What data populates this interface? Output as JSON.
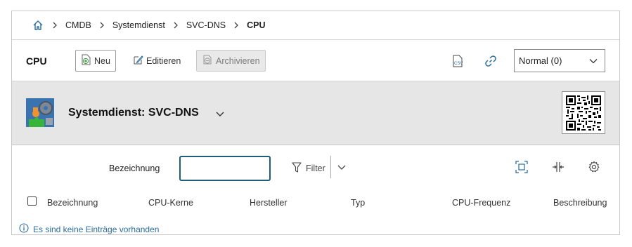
{
  "breadcrumb": {
    "items": [
      "CMDB",
      "Systemdienst",
      "SVC-DNS",
      "CPU"
    ]
  },
  "toolbar": {
    "title": "CPU",
    "new_label": "Neu",
    "edit_label": "Editieren",
    "archive_label": "Archivieren",
    "view_select": "Normal (0)"
  },
  "object": {
    "title": "Systemdienst: SVC-DNS"
  },
  "filter": {
    "label": "Bezeichnung",
    "value": "",
    "button_label": "Filter"
  },
  "table": {
    "columns": [
      "Bezeichnung",
      "CPU-Kerne",
      "Hersteller",
      "Typ",
      "CPU-Frequenz",
      "Beschreibung"
    ],
    "rows": []
  },
  "empty_message": "Es sind keine Einträge vorhanden",
  "colors": {
    "accent": "#1f5d7a",
    "link": "#2a6d9c",
    "header_bg": "#e6e6e6"
  }
}
